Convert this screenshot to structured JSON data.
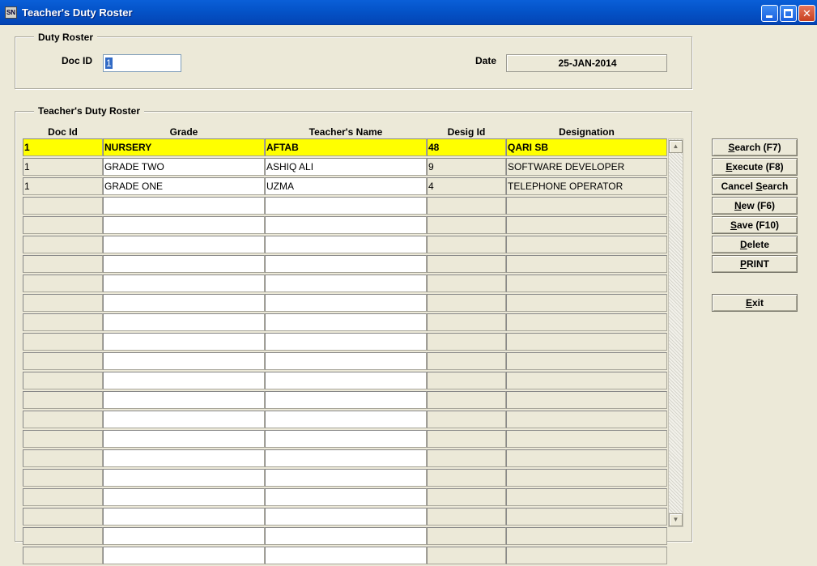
{
  "window": {
    "title": "Teacher's Duty Roster",
    "icon_text": "SN"
  },
  "header_section": {
    "label": "Duty Roster",
    "doc_id_label": "Doc ID",
    "doc_id_value": "1",
    "date_label": "Date",
    "date_value": "25-JAN-2014"
  },
  "grid_section": {
    "label": "Teacher's Duty Roster",
    "columns": [
      "Doc Id",
      "Grade",
      "Teacher's Name",
      "Desig Id",
      "Designation"
    ],
    "rows": [
      {
        "doc_id": "1",
        "grade": "NURSERY",
        "teacher": "AFTAB",
        "desig_id": "48",
        "designation": "QARI SB",
        "current": true
      },
      {
        "doc_id": "1",
        "grade": "GRADE TWO",
        "teacher": "ASHIQ ALI",
        "desig_id": "9",
        "designation": "SOFTWARE DEVELOPER"
      },
      {
        "doc_id": "1",
        "grade": "GRADE ONE",
        "teacher": "UZMA",
        "desig_id": "4",
        "designation": "TELEPHONE OPERATOR"
      },
      {},
      {},
      {},
      {},
      {},
      {},
      {},
      {},
      {},
      {},
      {},
      {},
      {},
      {},
      {},
      {},
      {},
      {},
      {}
    ]
  },
  "buttons": [
    {
      "key": "search",
      "accel": "S",
      "rest": "earch (F7)"
    },
    {
      "key": "execute",
      "accel": "E",
      "rest": "xecute (F8)"
    },
    {
      "key": "cancel-search",
      "pre": "Cancel ",
      "accel": "S",
      "rest": "earch"
    },
    {
      "key": "new",
      "accel": "N",
      "rest": "ew (F6)"
    },
    {
      "key": "save",
      "accel": "S",
      "rest": "ave (F10)"
    },
    {
      "key": "delete",
      "accel": "D",
      "rest": "elete"
    },
    {
      "key": "print",
      "accel": "P",
      "rest": "RINT"
    },
    {
      "key": "exit",
      "accel": "E",
      "rest": "xit"
    }
  ],
  "colors": {
    "current_row": "#ffff00",
    "titlebar": "#0453c8",
    "selection": "#316ac5"
  }
}
